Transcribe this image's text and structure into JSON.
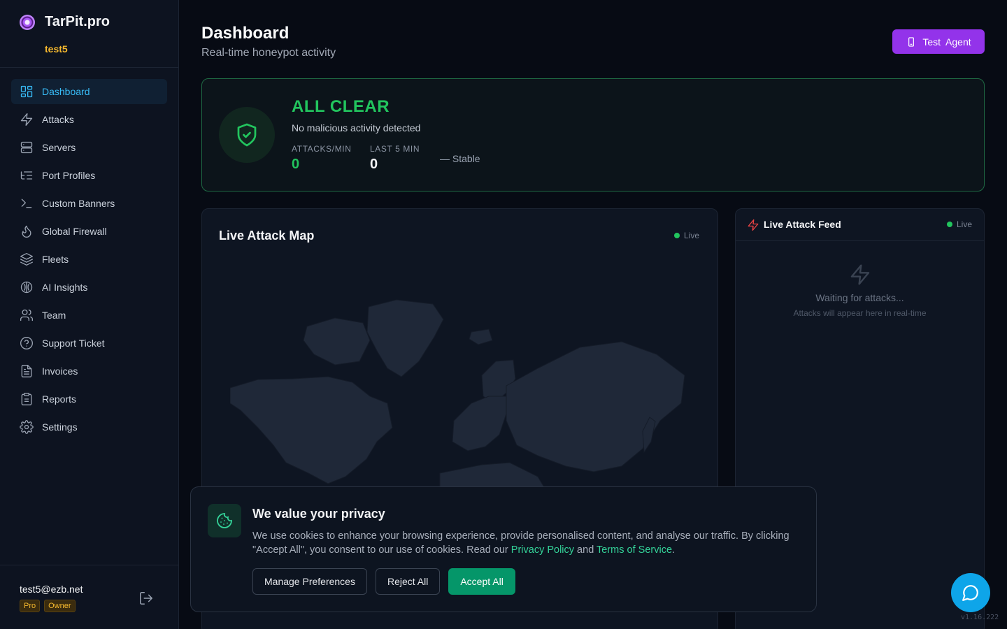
{
  "brand": {
    "name": "TarPit.pro",
    "user": "test5"
  },
  "nav": [
    {
      "label": "Dashboard",
      "icon": "dashboard-grid-icon",
      "active": true
    },
    {
      "label": "Attacks",
      "icon": "lightning-icon"
    },
    {
      "label": "Servers",
      "icon": "server-icon"
    },
    {
      "label": "Port Profiles",
      "icon": "list-tree-icon"
    },
    {
      "label": "Custom Banners",
      "icon": "terminal-icon"
    },
    {
      "label": "Global Firewall",
      "icon": "flame-icon"
    },
    {
      "label": "Fleets",
      "icon": "layers-icon"
    },
    {
      "label": "AI Insights",
      "icon": "brain-icon"
    },
    {
      "label": "Team",
      "icon": "users-icon"
    },
    {
      "label": "Support Ticket",
      "icon": "help-circle-icon"
    },
    {
      "label": "Invoices",
      "icon": "file-text-icon"
    },
    {
      "label": "Reports",
      "icon": "clipboard-icon"
    },
    {
      "label": "Settings",
      "icon": "gear-icon"
    }
  ],
  "account": {
    "email": "test5@ezb.net",
    "badges": [
      "Pro",
      "Owner"
    ]
  },
  "header": {
    "title": "Dashboard",
    "subtitle": "Real-time honeypot activity",
    "test_agent_label": "Test  Agent"
  },
  "status": {
    "title": "ALL CLEAR",
    "description": "No malicious activity detected",
    "attacks_per_min_label": "ATTACKS/MIN",
    "attacks_per_min_value": "0",
    "last5_label": "LAST 5 MIN",
    "last5_value": "0",
    "trend": "— Stable",
    "accent": "#22c55e"
  },
  "map": {
    "title": "Live Attack Map",
    "live_label": "Live"
  },
  "feed": {
    "title": "Live Attack Feed",
    "live_label": "Live",
    "empty_title": "Waiting for attacks...",
    "empty_sub": "Attacks will appear here in real-time"
  },
  "cookie": {
    "title": "We value your privacy",
    "text_before": "We use cookies to enhance your browsing experience, provide personalised content, and analyse our traffic. By clicking \"Accept All\", you consent to our use of cookies. Read our ",
    "privacy_link": "Privacy Policy",
    "and": " and ",
    "terms_link": "Terms of Service",
    "period": ".",
    "manage_label": "Manage Preferences",
    "reject_label": "Reject All",
    "accept_label": "Accept All"
  },
  "version": "v1.16.222",
  "colors": {
    "brand_purple": "#9333ea",
    "active_blue": "#38bdf8",
    "success": "#22c55e",
    "user_gold": "#f5b82e",
    "chat": "#0ea5e9"
  }
}
